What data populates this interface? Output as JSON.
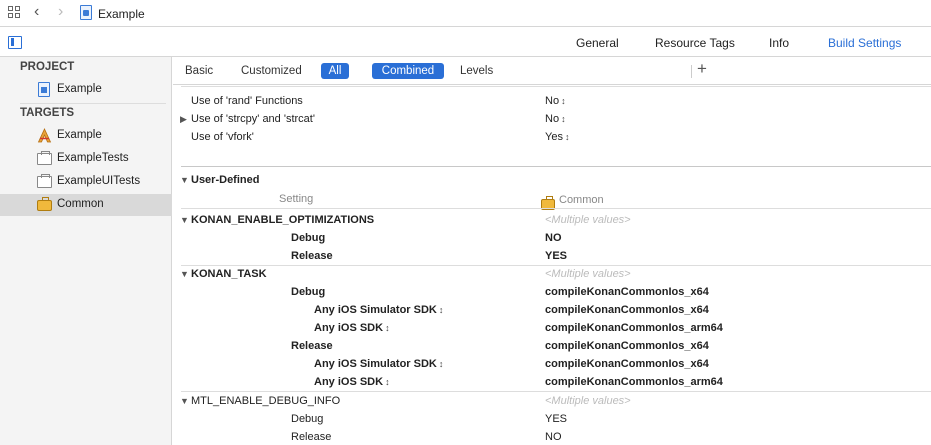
{
  "topbar": {
    "breadcrumb": "Example"
  },
  "tabs": [
    {
      "label": "General"
    },
    {
      "label": "Resource Tags"
    },
    {
      "label": "Info"
    },
    {
      "label": "Build Settings"
    }
  ],
  "sidebar": {
    "project_header": "PROJECT",
    "project_item": "Example",
    "targets_header": "TARGETS",
    "targets": [
      {
        "label": "Example"
      },
      {
        "label": "ExampleTests"
      },
      {
        "label": "ExampleUITests"
      },
      {
        "label": "Common"
      }
    ]
  },
  "filters": {
    "basic": "Basic",
    "customized": "Customized",
    "all": "All",
    "combined": "Combined",
    "levels": "Levels",
    "add": "+"
  },
  "settings_top": [
    {
      "name": "Use of 'rand' Functions",
      "value": "No"
    },
    {
      "name": "Use of 'strcpy' and 'strcat'",
      "value": "No"
    },
    {
      "name": "Use of 'vfork'",
      "value": "Yes"
    }
  ],
  "user_defined": {
    "title": "User-Defined",
    "col_setting": "Setting",
    "col_target": "Common",
    "konan_opt": {
      "name": "KONAN_ENABLE_OPTIMIZATIONS",
      "value": "<Multiple values>",
      "debug_label": "Debug",
      "debug_value": "NO",
      "release_label": "Release",
      "release_value": "YES"
    },
    "konan_task": {
      "name": "KONAN_TASK",
      "value": "<Multiple values>",
      "debug_label": "Debug",
      "debug_value": "compileKonanCommonIos_x64",
      "debug_sim_label": "Any iOS Simulator SDK",
      "debug_sim_value": "compileKonanCommonIos_x64",
      "debug_sdk_label": "Any iOS SDK",
      "debug_sdk_value": "compileKonanCommonIos_arm64",
      "release_label": "Release",
      "release_value": "compileKonanCommonIos_x64",
      "release_sim_label": "Any iOS Simulator SDK",
      "release_sim_value": "compileKonanCommonIos_x64",
      "release_sdk_label": "Any iOS SDK",
      "release_sdk_value": "compileKonanCommonIos_arm64"
    },
    "mtl": {
      "name": "MTL_ENABLE_DEBUG_INFO",
      "value": "<Multiple values>",
      "debug_label": "Debug",
      "debug_value": "YES",
      "release_label": "Release",
      "release_value": "NO"
    }
  }
}
